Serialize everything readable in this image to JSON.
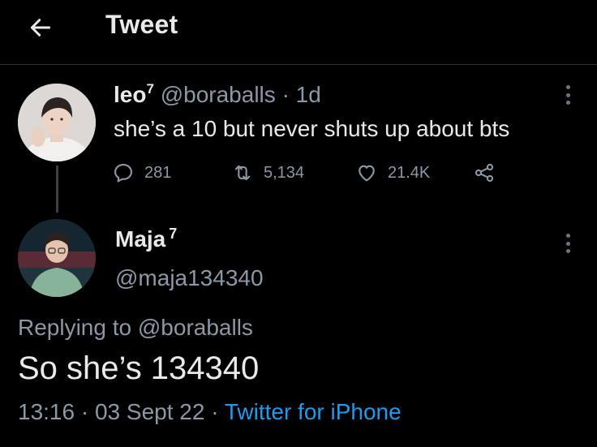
{
  "header": {
    "title": "Tweet"
  },
  "parent_tweet": {
    "display_name": "leo",
    "name_superscript": "7",
    "handle": "@boraballs",
    "separator": "·",
    "time": "1d",
    "text": "she’s a 10 but never shuts up about bts",
    "reply_count": "281",
    "retweet_count": "5,134",
    "like_count": "21.4K"
  },
  "main_tweet": {
    "display_name": "Maja",
    "name_superscript": "7",
    "handle": "@maja134340",
    "replying_prefix": "Replying to",
    "replying_handle": "@boraballs",
    "text": "So she’s 134340",
    "time": "13:16",
    "date": "03 Sept 22",
    "separator": "·",
    "source": "Twitter for iPhone"
  },
  "colors": {
    "background": "#000000",
    "text_primary": "#e7e9ea",
    "text_secondary": "#8b98a5",
    "link": "#1d9bf0",
    "divider": "#2f3336"
  },
  "icons": [
    "back-arrow-icon",
    "more-icon",
    "reply-icon",
    "retweet-icon",
    "like-icon",
    "share-icon"
  ]
}
